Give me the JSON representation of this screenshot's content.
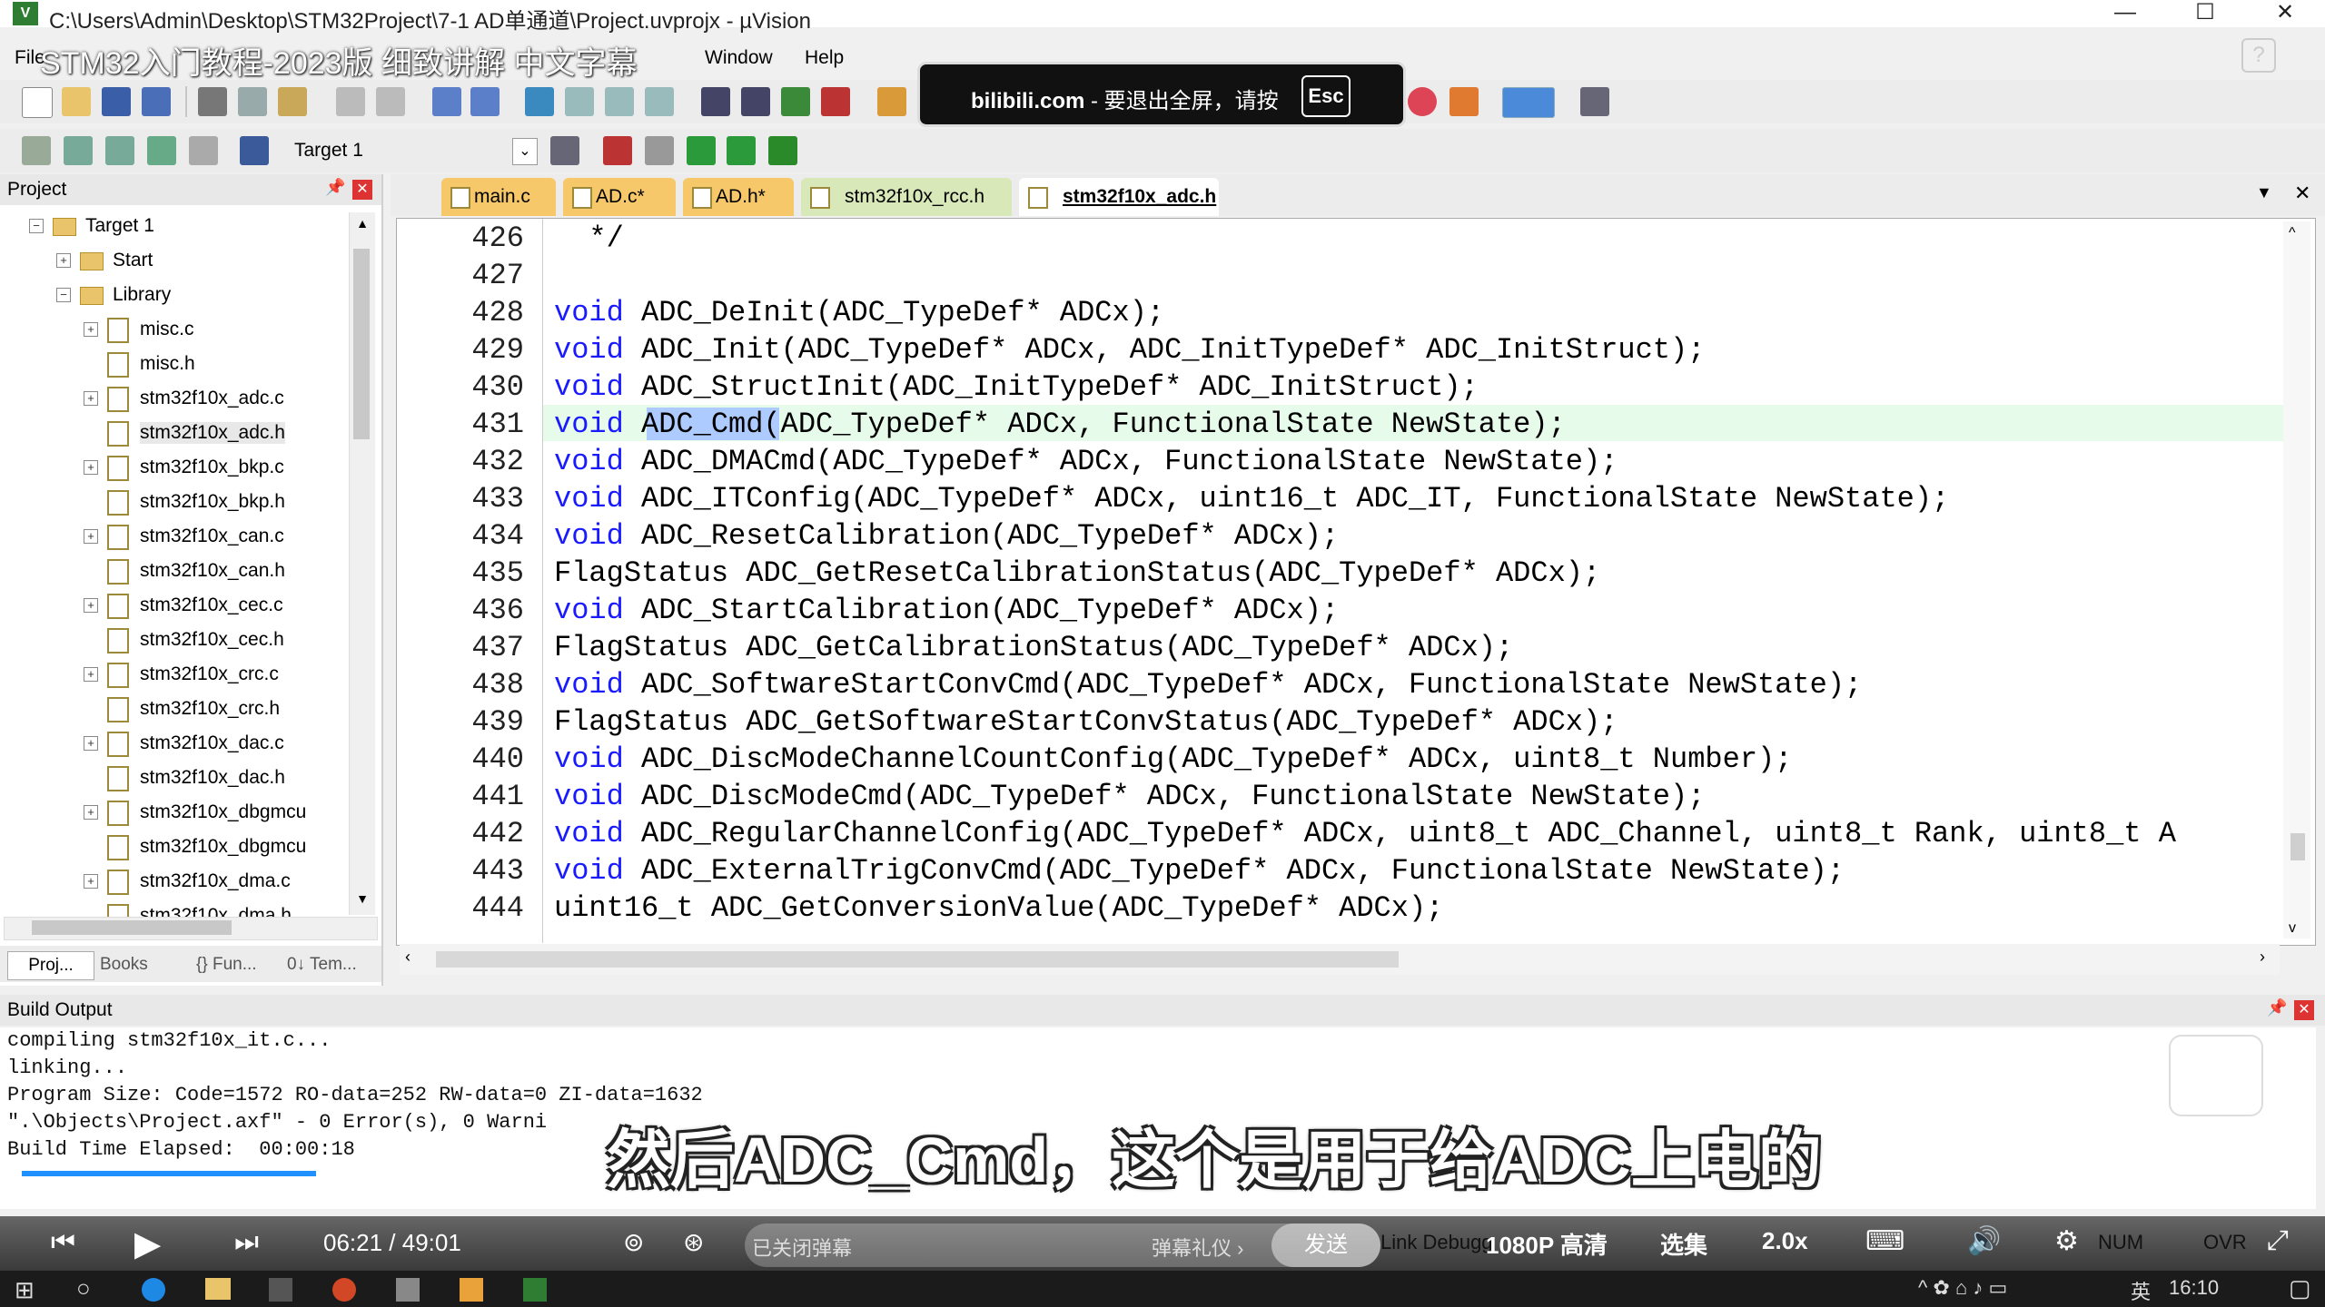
{
  "window": {
    "title": "C:\\Users\\Admin\\Desktop\\STM32Project\\7-1 AD单通道\\Project.uvprojx - µVision",
    "min": "—",
    "max": "☐",
    "close": "✕"
  },
  "menu": [
    "File",
    "Window",
    "Help"
  ],
  "overlay_title": "STM32入门教程-2023版 细致讲解 中文字幕",
  "notice": {
    "site": "bilibili.com",
    "text": "- 要退出全屏，请按",
    "key": "Esc"
  },
  "toolbar2": {
    "target": "Target 1"
  },
  "project": {
    "title": "Project",
    "tree": [
      {
        "label": "Target 1",
        "type": "folder",
        "level": 0,
        "exp": "⊟"
      },
      {
        "label": "Start",
        "type": "folder",
        "level": 1,
        "exp": "⊞"
      },
      {
        "label": "Library",
        "type": "folder",
        "level": 1,
        "exp": "⊟"
      },
      {
        "label": "misc.c",
        "type": "file",
        "level": 2,
        "exp": "⊞"
      },
      {
        "label": "misc.h",
        "type": "file",
        "level": 2,
        "exp": ""
      },
      {
        "label": "stm32f10x_adc.c",
        "type": "file",
        "level": 2,
        "exp": "⊞"
      },
      {
        "label": "stm32f10x_adc.h",
        "type": "file",
        "level": 2,
        "exp": ""
      },
      {
        "label": "stm32f10x_bkp.c",
        "type": "file",
        "level": 2,
        "exp": "⊞"
      },
      {
        "label": "stm32f10x_bkp.h",
        "type": "file",
        "level": 2,
        "exp": ""
      },
      {
        "label": "stm32f10x_can.c",
        "type": "file",
        "level": 2,
        "exp": "⊞"
      },
      {
        "label": "stm32f10x_can.h",
        "type": "file",
        "level": 2,
        "exp": ""
      },
      {
        "label": "stm32f10x_cec.c",
        "type": "file",
        "level": 2,
        "exp": "⊞"
      },
      {
        "label": "stm32f10x_cec.h",
        "type": "file",
        "level": 2,
        "exp": ""
      },
      {
        "label": "stm32f10x_crc.c",
        "type": "file",
        "level": 2,
        "exp": "⊞"
      },
      {
        "label": "stm32f10x_crc.h",
        "type": "file",
        "level": 2,
        "exp": ""
      },
      {
        "label": "stm32f10x_dac.c",
        "type": "file",
        "level": 2,
        "exp": "⊞"
      },
      {
        "label": "stm32f10x_dac.h",
        "type": "file",
        "level": 2,
        "exp": ""
      },
      {
        "label": "stm32f10x_dbgmcu",
        "type": "file",
        "level": 2,
        "exp": "⊞"
      },
      {
        "label": "stm32f10x_dbgmcu",
        "type": "file",
        "level": 2,
        "exp": ""
      },
      {
        "label": "stm32f10x_dma.c",
        "type": "file",
        "level": 2,
        "exp": "⊞"
      },
      {
        "label": "stm32f10x_dma.h",
        "type": "file",
        "level": 2,
        "exp": ""
      }
    ],
    "bottom_tabs": [
      "Proj...",
      "Books",
      "{} Fun...",
      "0↓ Tem..."
    ]
  },
  "tabs": [
    {
      "label": "main.c",
      "color": "#f6c86a"
    },
    {
      "label": "AD.c*",
      "color": "#f6c86a"
    },
    {
      "label": "AD.h*",
      "color": "#f6c86a"
    },
    {
      "label": "stm32f10x_rcc.h",
      "color": "#d8e8b8"
    },
    {
      "label": "stm32f10x_adc.h",
      "color": "#d8e8b8"
    }
  ],
  "code": [
    {
      "n": "426",
      "kw": "",
      "rest": "  */"
    },
    {
      "n": "427",
      "kw": "",
      "rest": ""
    },
    {
      "n": "428",
      "kw": "void",
      "rest": " ADC_DeInit(ADC_TypeDef* ADCx);"
    },
    {
      "n": "429",
      "kw": "void",
      "rest": " ADC_Init(ADC_TypeDef* ADCx, ADC_InitTypeDef* ADC_InitStruct);"
    },
    {
      "n": "430",
      "kw": "void",
      "rest": " ADC_StructInit(ADC_InitTypeDef* ADC_InitStruct);"
    },
    {
      "n": "431",
      "kw": "void",
      "rest": " ADC_Cmd(ADC_TypeDef* ADCx, FunctionalState NewState);"
    },
    {
      "n": "432",
      "kw": "void",
      "rest": " ADC_DMACmd(ADC_TypeDef* ADCx, FunctionalState NewState);"
    },
    {
      "n": "433",
      "kw": "void",
      "rest": " ADC_ITConfig(ADC_TypeDef* ADCx, uint16_t ADC_IT, FunctionalState NewState);"
    },
    {
      "n": "434",
      "kw": "void",
      "rest": " ADC_ResetCalibration(ADC_TypeDef* ADCx);"
    },
    {
      "n": "435",
      "kw": "",
      "rest": "FlagStatus ADC_GetResetCalibrationStatus(ADC_TypeDef* ADCx);"
    },
    {
      "n": "436",
      "kw": "void",
      "rest": " ADC_StartCalibration(ADC_TypeDef* ADCx);"
    },
    {
      "n": "437",
      "kw": "",
      "rest": "FlagStatus ADC_GetCalibrationStatus(ADC_TypeDef* ADCx);"
    },
    {
      "n": "438",
      "kw": "void",
      "rest": " ADC_SoftwareStartConvCmd(ADC_TypeDef* ADCx, FunctionalState NewState);"
    },
    {
      "n": "439",
      "kw": "",
      "rest": "FlagStatus ADC_GetSoftwareStartConvStatus(ADC_TypeDef* ADCx);"
    },
    {
      "n": "440",
      "kw": "void",
      "rest": " ADC_DiscModeChannelCountConfig(ADC_TypeDef* ADCx, uint8_t Number);"
    },
    {
      "n": "441",
      "kw": "void",
      "rest": " ADC_DiscModeCmd(ADC_TypeDef* ADCx, FunctionalState NewState);"
    },
    {
      "n": "442",
      "kw": "void",
      "rest": " ADC_RegularChannelConfig(ADC_TypeDef* ADCx, uint8_t ADC_Channel, uint8_t Rank, uint8_t A"
    },
    {
      "n": "443",
      "kw": "void",
      "rest": " ADC_ExternalTrigConvCmd(ADC_TypeDef* ADCx, FunctionalState NewState);"
    },
    {
      "n": "444",
      "kw": "",
      "rest": "uint16_t ADC_GetConversionValue(ADC_TypeDef* ADCx);"
    }
  ],
  "build": {
    "title": "Build Output",
    "lines": [
      "compiling stm32f10x_it.c...",
      "linking...",
      "Program Size: Code=1572 RO-data=252 RW-data=0 ZI-data=1632",
      "\".\\Objects\\Project.axf\" - 0 Error(s), 0 Warni",
      "Build Time Elapsed:  00:00:18"
    ]
  },
  "subtitle": "然后ADC_Cmd，这个是用于给ADC上电的",
  "player": {
    "time": "06:21 / 49:01",
    "danmu_placeholder": "已关闭弹幕",
    "gift": "弹幕礼仪 ›",
    "send": "发送",
    "link": "Link Debugg",
    "quality": "1080P 高清",
    "episodes": "选集",
    "speed": "2.0x",
    "status_right": "NUM",
    "ovr": "OVR"
  },
  "taskbar": {
    "ime": "英",
    "time": "16:10"
  }
}
